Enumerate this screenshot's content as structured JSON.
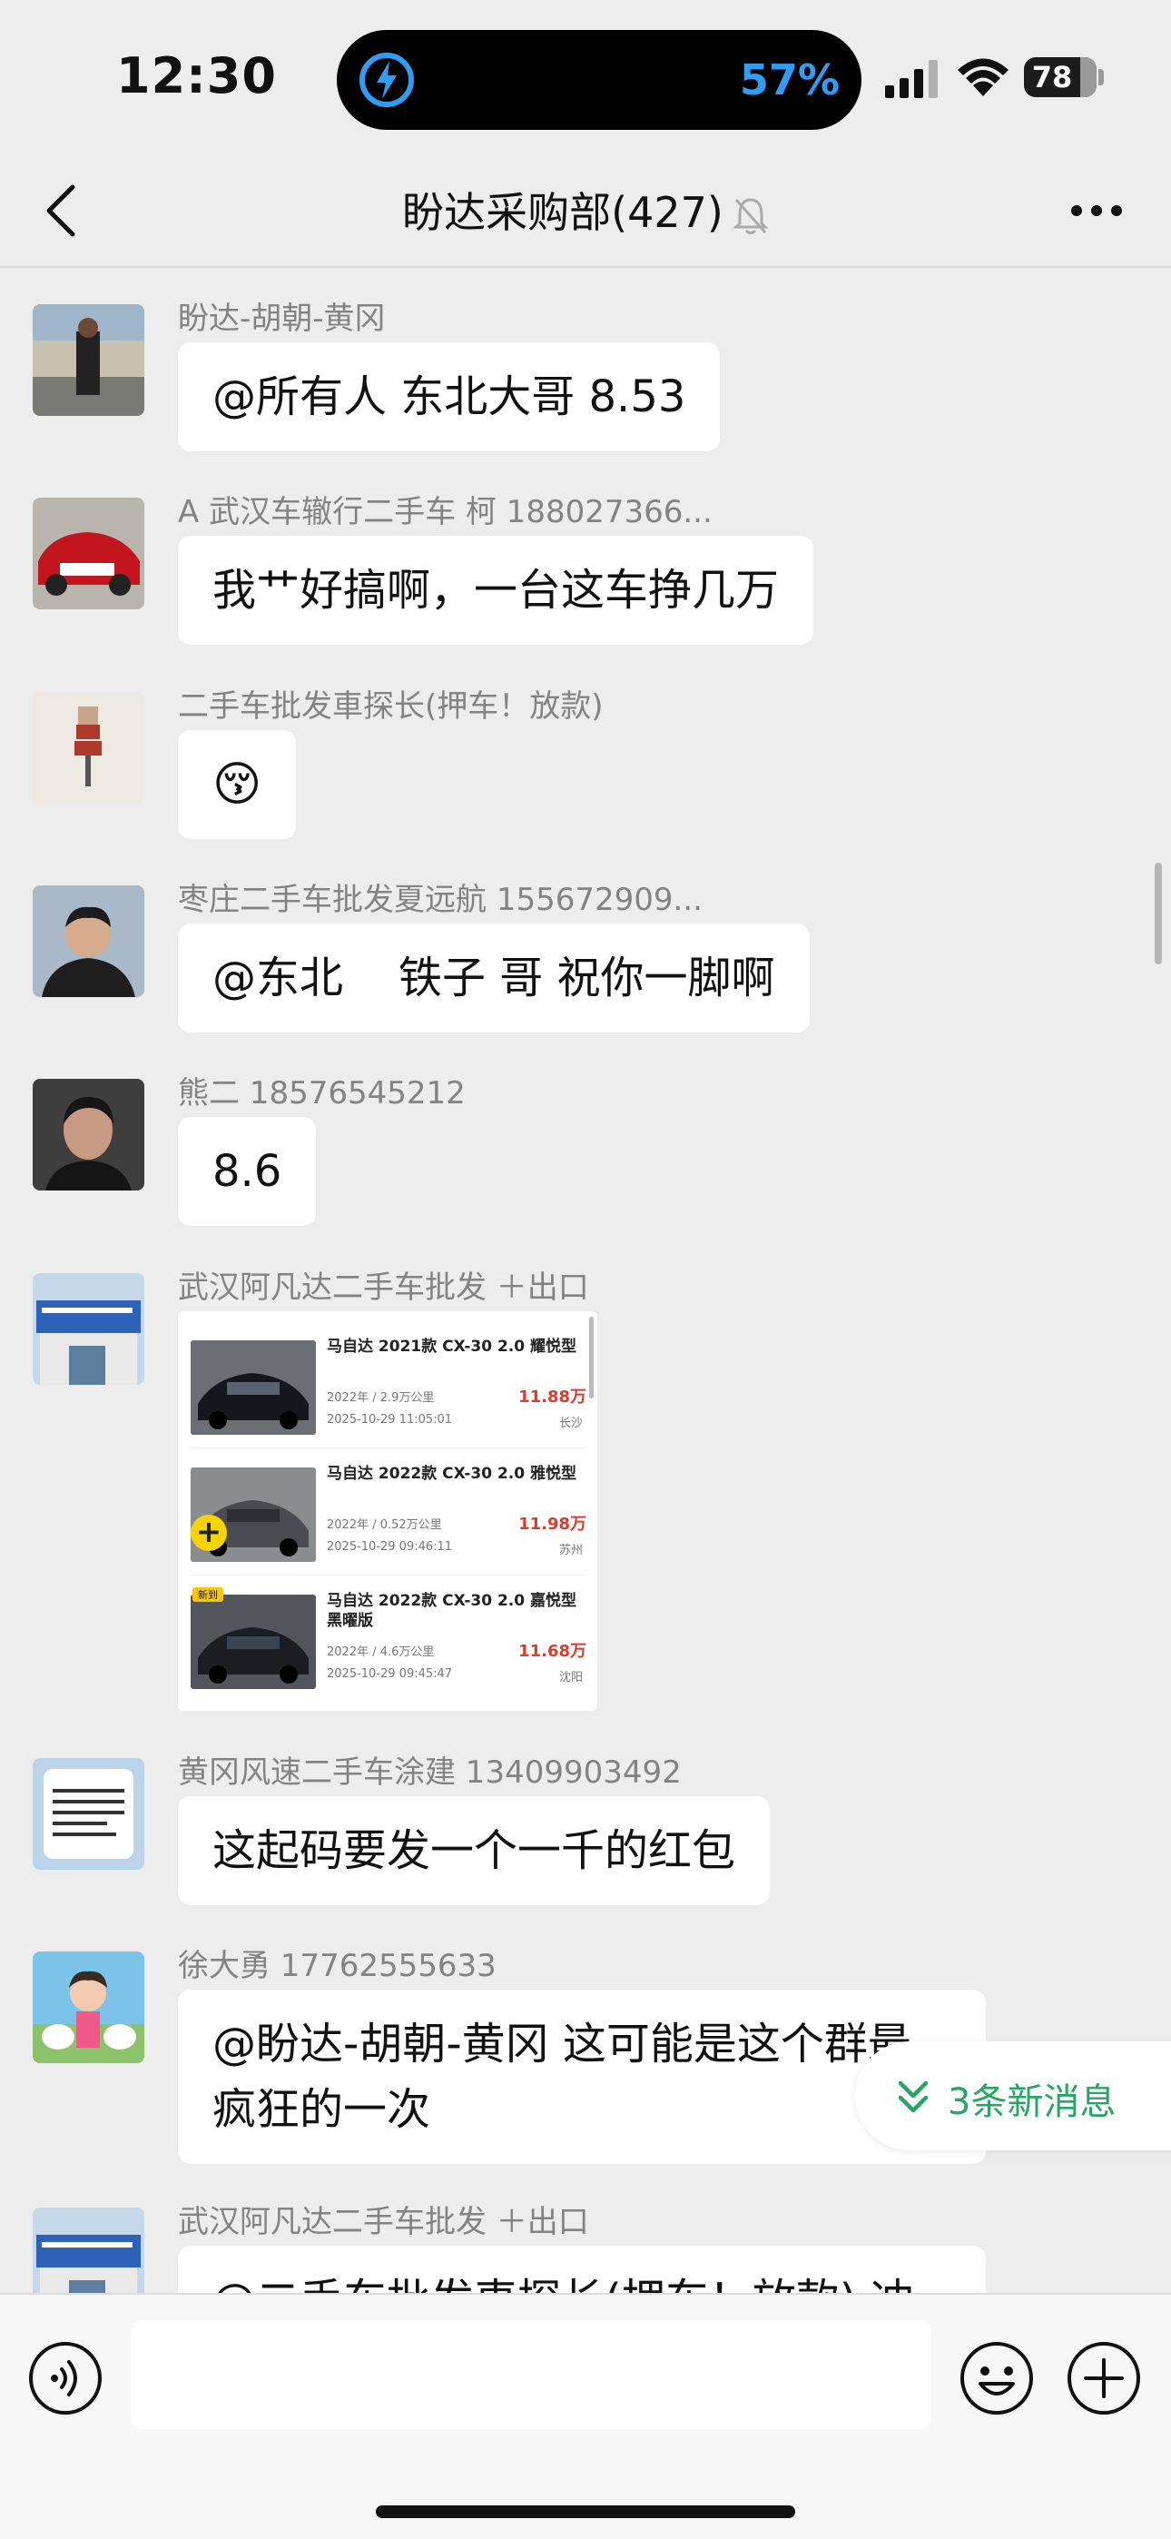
{
  "status": {
    "time": "12:30",
    "battery_saver_pct": "57%",
    "battery_level": "78"
  },
  "nav": {
    "title": "盼达采购部(427)"
  },
  "messages": [
    {
      "sender": "盼达-胡朝-黄冈",
      "text": "@所有人 东北大哥 8.53"
    },
    {
      "sender": "A 武汉车辙行二手车 柯 188027366...",
      "text": "我艹好搞啊，一台这车挣几万"
    },
    {
      "sender": "二手车批发車探长(押车！放款)",
      "text": "😚"
    },
    {
      "sender": "枣庄二手车批发夏远航 155672909...",
      "text": "@东北    铁子 哥 祝你一脚啊"
    },
    {
      "sender": "熊二 18576545212",
      "text": "8.6"
    },
    {
      "sender": "武汉阿凡达二手车批发 ＋出口",
      "text": ""
    },
    {
      "sender": "黄冈风速二手车涂建 13409903492",
      "text": "这起码要发一个一千的红包"
    },
    {
      "sender": "徐大勇 17762555633",
      "text": "@盼达-胡朝-黄冈 这可能是这个群最疯狂的一次"
    },
    {
      "sender": "武汉阿凡达二手车批发 ＋出口",
      "text": "@二手车批发車探长(押车！放款) 冲"
    }
  ],
  "card": {
    "cars": [
      {
        "title": "马自达 2021款 CX-30 2.0 耀悦型",
        "meta": "2022年 / 2.9万公里",
        "date": "2025-10-29 11:05:01",
        "price": "11.88万",
        "city": "长沙"
      },
      {
        "title": "马自达 2022款 CX-30 2.0 雅悦型",
        "meta": "2022年 / 0.52万公里",
        "date": "2025-10-29 09:46:11",
        "price": "11.98万",
        "city": "苏州"
      },
      {
        "title": "马自达 2022款 CX-30 2.0 嘉悦型黑曜版",
        "meta": "2022年 / 4.6万公里",
        "date": "2025-10-29 09:45:47",
        "price": "11.68万",
        "city": "沈阳",
        "tag": "新到"
      }
    ]
  },
  "new_messages": {
    "label": "3条新消息"
  },
  "colors": {
    "accent_green": "#26a567",
    "price_red": "#e13a2a",
    "saver_blue": "#2f9df4"
  }
}
